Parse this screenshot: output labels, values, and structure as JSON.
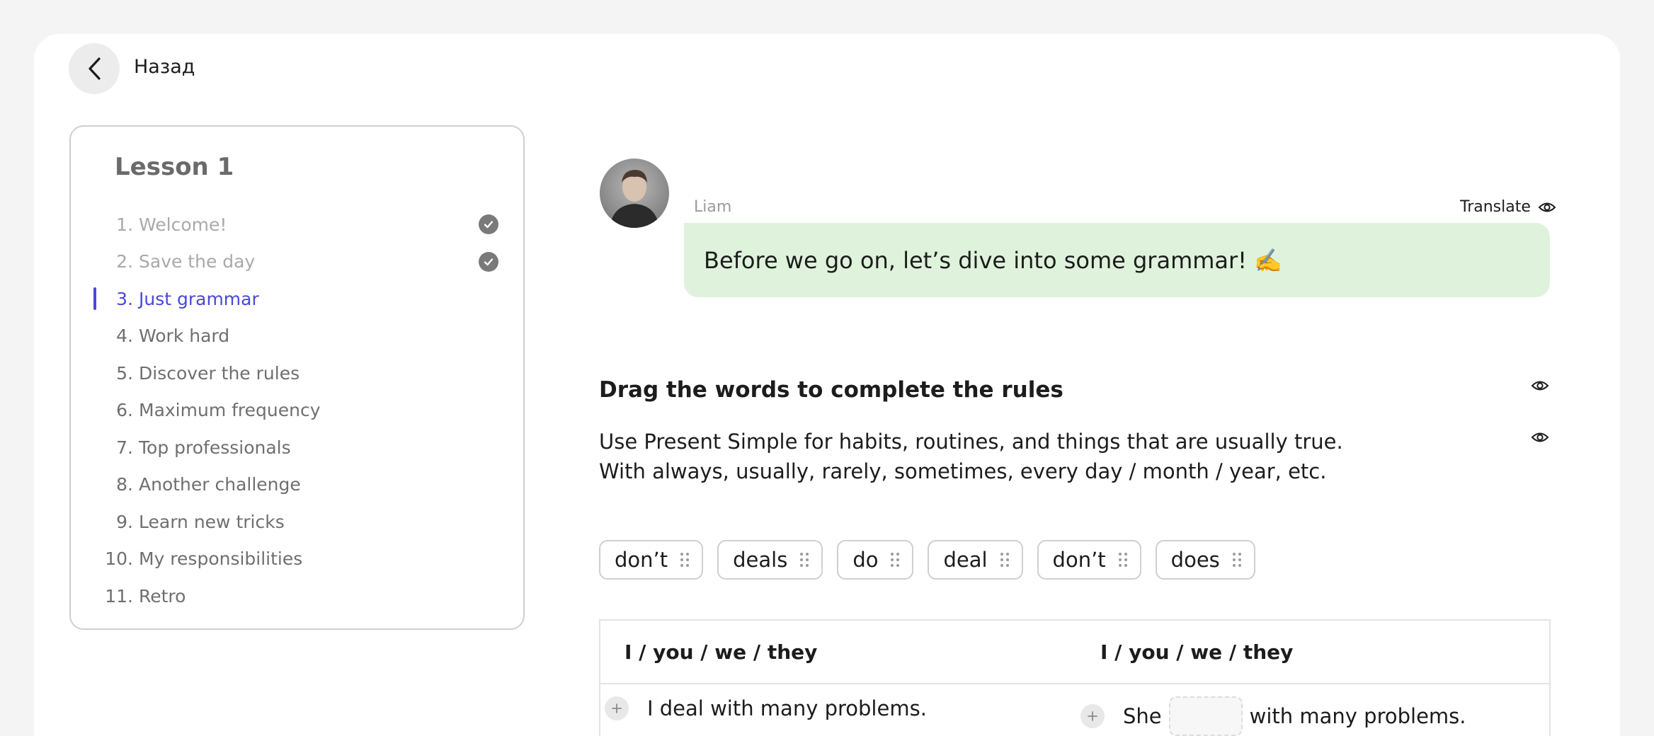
{
  "nav": {
    "back_label": "Назад"
  },
  "lesson": {
    "title": "Lesson 1",
    "items": [
      {
        "num": "1.",
        "label": "Welcome!",
        "state": "done"
      },
      {
        "num": "2.",
        "label": "Save the day",
        "state": "done"
      },
      {
        "num": "3.",
        "label": "Just grammar",
        "state": "active"
      },
      {
        "num": "4.",
        "label": "Work hard",
        "state": "todo"
      },
      {
        "num": "5.",
        "label": "Discover the rules",
        "state": "todo"
      },
      {
        "num": "6.",
        "label": "Maximum frequency",
        "state": "todo"
      },
      {
        "num": "7.",
        "label": "Top professionals",
        "state": "todo"
      },
      {
        "num": "8.",
        "label": "Another challenge",
        "state": "todo"
      },
      {
        "num": "9.",
        "label": "Learn new tricks",
        "state": "todo"
      },
      {
        "num": "10.",
        "label": "My responsibilities",
        "state": "todo"
      },
      {
        "num": "11.",
        "label": "Retro",
        "state": "todo"
      }
    ]
  },
  "chat": {
    "sender": "Liam",
    "translate_label": "Translate",
    "message": "Before we go on, let’s dive into some grammar! ✍️"
  },
  "task": {
    "title": "Drag the words to complete the rules",
    "rule_line1": "Use Present Simple for habits, routines, and things that are usually true.",
    "rule_line2": "With always, usually, rarely, sometimes, every day / month / year, etc.",
    "chips": [
      "don’t",
      "deals",
      "do",
      "deal",
      "don’t",
      "does"
    ]
  },
  "table": {
    "col1_header": "I / you / we / they",
    "col2_header": "I / you / we / they",
    "row1_col1": "I deal with many problems.",
    "row1_col2_before": "She",
    "row1_col2_after": "with many problems."
  },
  "colors": {
    "accent": "#4a48d6",
    "bubble": "#dff3dc",
    "muted": "#a9a9a9"
  }
}
